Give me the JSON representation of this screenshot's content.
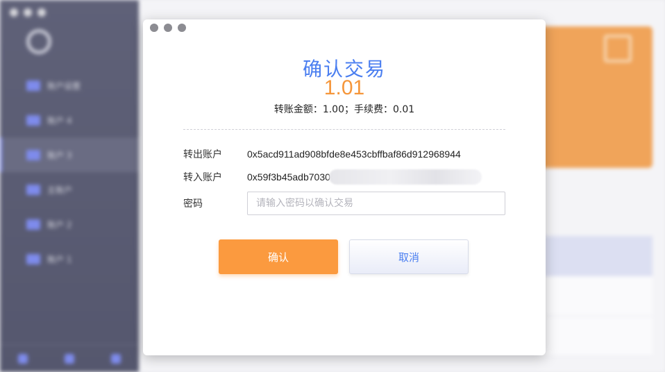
{
  "dialog": {
    "title": "确认交易",
    "amount": "1.01",
    "fee_line": "转账金额：1.00；手续费：0.01",
    "from_label": "转出账户",
    "from_value": "0x5acd911ad908bfde8e453cbffbaf86d912968944",
    "to_label": "转入账户",
    "to_value": "0x59f3b45adb7030",
    "password_label": "密码",
    "password_placeholder": "请输入密码以确认交易",
    "password_value": "",
    "confirm_label": "确认",
    "cancel_label": "取消"
  },
  "colors": {
    "accent_blue": "#4a7ef0",
    "accent_orange": "#fb9a3f",
    "sidebar_bg": "#5f6178"
  },
  "background": {
    "sidebar_items": [
      "账户设置",
      "账户 4",
      "账户 3",
      "主账户",
      "账户 2",
      "账户 1"
    ]
  }
}
